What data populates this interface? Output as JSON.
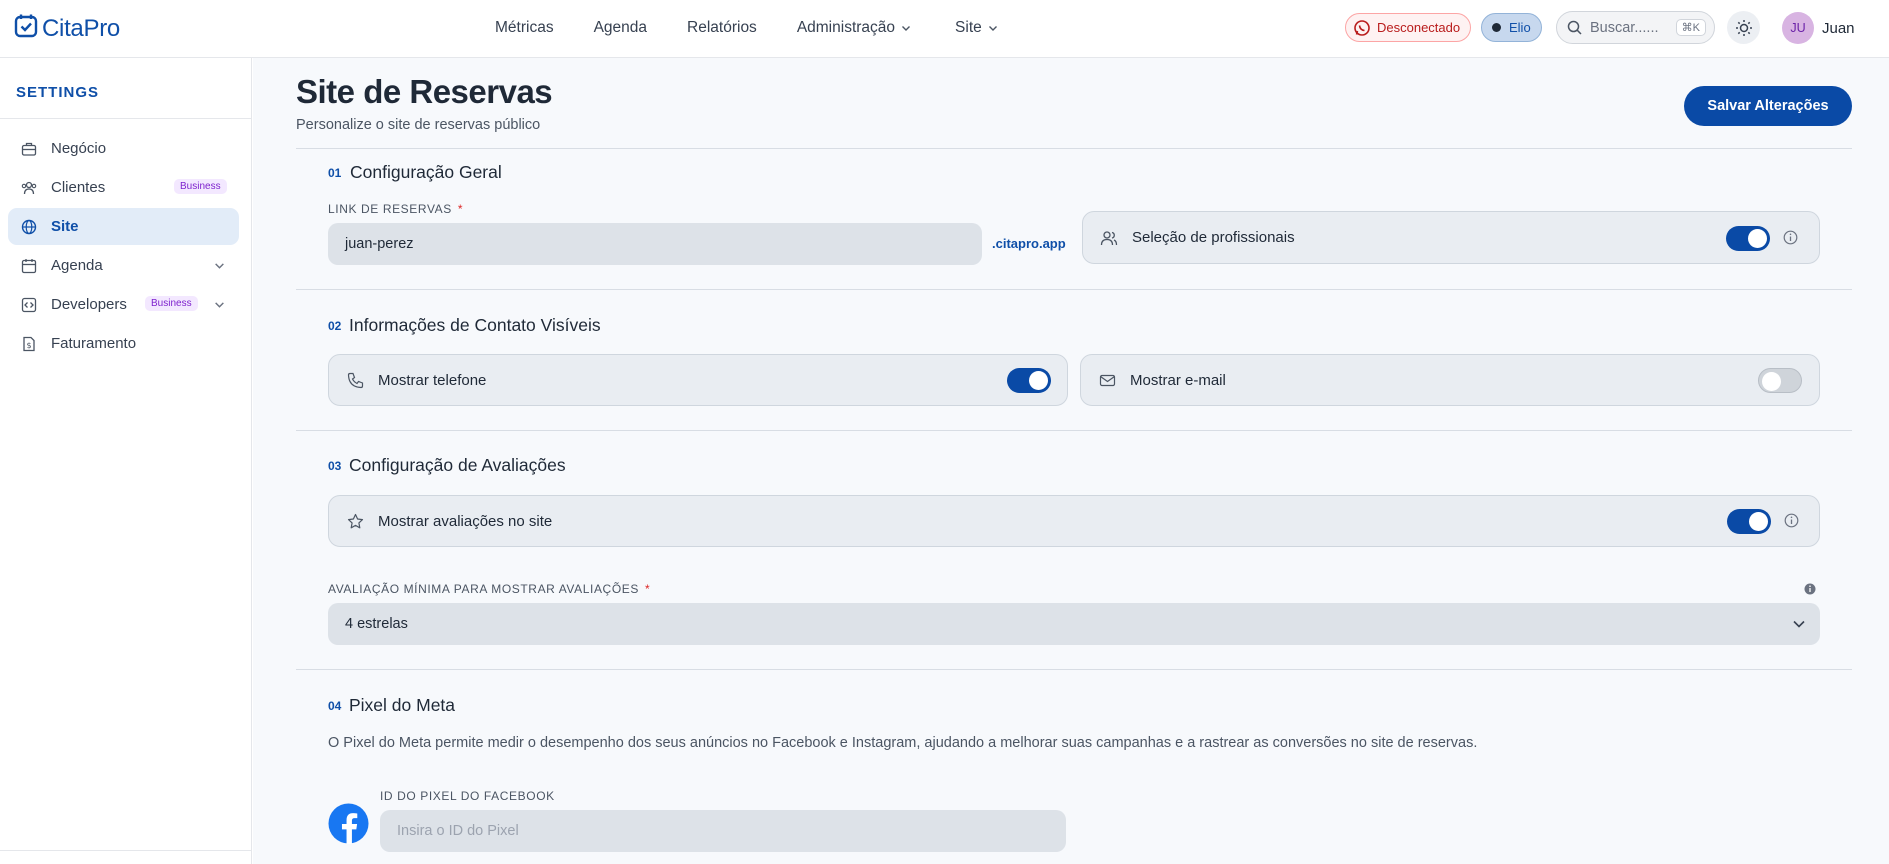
{
  "header": {
    "logo_text": "CitaPro",
    "nav": [
      "Métricas",
      "Agenda",
      "Relatórios",
      "Administração",
      "Site"
    ],
    "status_label": "Desconectado",
    "assistant_label": "Elio",
    "search_placeholder": "Buscar......",
    "search_shortcut": "⌘K",
    "user_initials": "JU",
    "user_name": "Juan"
  },
  "sidebar": {
    "title": "SETTINGS",
    "items": [
      {
        "label": "Negócio",
        "icon": "briefcase-icon",
        "badge": "",
        "active": false
      },
      {
        "label": "Clientes",
        "icon": "users-icon",
        "badge": "Business",
        "active": false
      },
      {
        "label": "Site",
        "icon": "globe-icon",
        "badge": "",
        "active": true
      },
      {
        "label": "Agenda",
        "icon": "calendar-icon",
        "badge": "",
        "active": false
      },
      {
        "label": "Developers",
        "icon": "code-icon",
        "badge": "Business",
        "active": false
      },
      {
        "label": "Faturamento",
        "icon": "invoice-icon",
        "badge": "",
        "active": false
      }
    ]
  },
  "page": {
    "title": "Site de Reservas",
    "subtitle": "Personalize o site de reservas público",
    "save_label": "Salvar Alterações"
  },
  "sections": {
    "general": {
      "num": "01",
      "title": "Configuração Geral",
      "link_label": "LINK DE RESERVAS",
      "required_mark": "*",
      "link_value": "juan-perez",
      "link_suffix": ".citapro.app",
      "professionals_label": "Seleção de profissionais",
      "professionals_on": true
    },
    "contact": {
      "num": "02",
      "title": "Informações de Contato Visíveis",
      "phone_label": "Mostrar telefone",
      "phone_on": true,
      "email_label": "Mostrar e-mail",
      "email_on": false
    },
    "reviews": {
      "num": "03",
      "title": "Configuração de Avaliações",
      "show_label": "Mostrar avaliações no site",
      "show_on": true,
      "min_label": "AVALIAÇÃO MÍNIMA PARA MOSTRAR AVALIAÇÕES",
      "min_value": "4 estrelas"
    },
    "pixel": {
      "num": "04",
      "title": "Pixel do Meta",
      "description": "O Pixel do Meta permite medir o desempenho dos seus anúncios no Facebook e Instagram, ajudando a melhorar suas campanhas e a rastrear as conversões no site de reservas.",
      "id_label": "ID DO PIXEL DO FACEBOOK",
      "id_placeholder": "Insira o ID do Pixel"
    }
  },
  "colors": {
    "brand": "#0a4aa6",
    "danger": "#b91c1c",
    "badge": "#7e22ce"
  }
}
